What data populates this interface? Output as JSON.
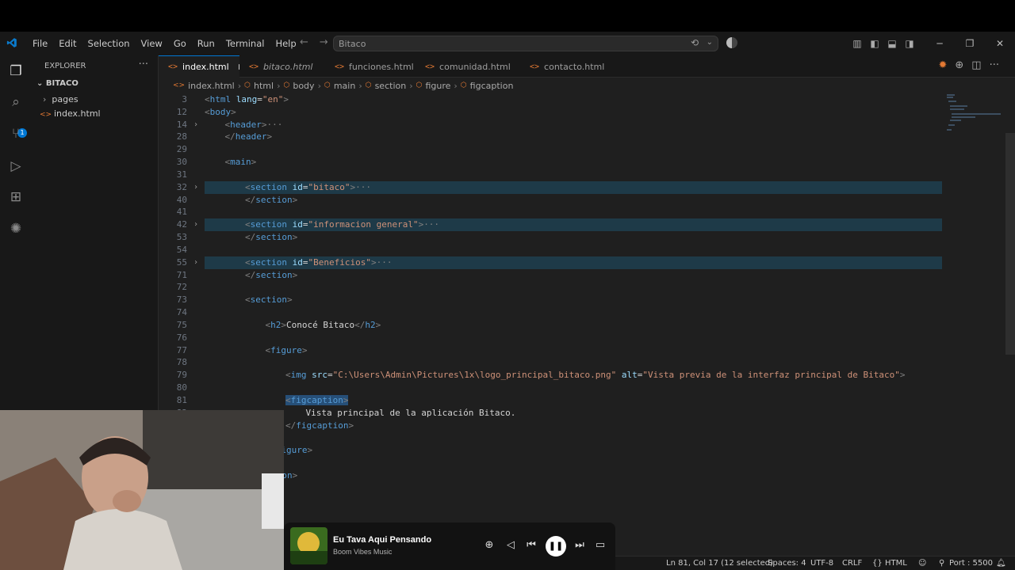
{
  "titlebar": {
    "menu": [
      "File",
      "Edit",
      "Selection",
      "View",
      "Go",
      "Run",
      "Terminal",
      "Help"
    ],
    "search": "Bitaco"
  },
  "sidebar": {
    "header": "EXPLORER",
    "more": "···",
    "root": "BITACO",
    "items": [
      {
        "label": "pages",
        "type": "folder"
      },
      {
        "label": "index.html",
        "type": "file"
      }
    ],
    "badge": "1"
  },
  "tabs": [
    {
      "label": "index.html",
      "active": true,
      "dirty": true
    },
    {
      "label": "bitaco.html",
      "active": false,
      "italic": true
    },
    {
      "label": "funciones.html",
      "active": false
    },
    {
      "label": "comunidad.html",
      "active": false
    },
    {
      "label": "contacto.html",
      "active": false
    }
  ],
  "breadcrumb": [
    "index.html",
    "html",
    "body",
    "main",
    "section",
    "figure",
    "figcaption"
  ],
  "editor": {
    "lines": [
      {
        "n": "3",
        "indent": 0,
        "html": "<span class='t-br'>&lt;</span><span class='t-tag'>html</span> <span class='t-attr'>lang</span><span class='t-txt'>=</span><span class='t-str'>\"en\"</span><span class='t-br'>&gt;</span>"
      },
      {
        "n": "12",
        "indent": 0,
        "html": "<span class='t-br'>&lt;</span><span class='t-tag'>body</span><span class='t-br'>&gt;</span>"
      },
      {
        "n": "14",
        "indent": 1,
        "fold": true,
        "html": "<span class='t-br'>&lt;</span><span class='t-tag'>header</span><span class='t-br'>&gt;</span><span class='t-br'>···</span>"
      },
      {
        "n": "28",
        "indent": 1,
        "html": "<span class='t-br'>&lt;/</span><span class='t-tag'>header</span><span class='t-br'>&gt;</span>"
      },
      {
        "n": "29",
        "indent": 0,
        "html": ""
      },
      {
        "n": "30",
        "indent": 1,
        "html": "<span class='t-br'>&lt;</span><span class='t-tag'>main</span><span class='t-br'>&gt;</span>"
      },
      {
        "n": "31",
        "indent": 0,
        "html": ""
      },
      {
        "n": "32",
        "indent": 2,
        "fold": true,
        "hl": true,
        "html": "<span class='t-br'>&lt;</span><span class='t-tag'>section</span> <span class='t-attr'>id</span><span class='t-txt'>=</span><span class='t-str'>\"bitaco\"</span><span class='t-br'>&gt;</span><span class='t-br'>···</span>"
      },
      {
        "n": "40",
        "indent": 2,
        "html": "<span class='t-br'>&lt;/</span><span class='t-tag'>section</span><span class='t-br'>&gt;</span>"
      },
      {
        "n": "41",
        "indent": 0,
        "html": ""
      },
      {
        "n": "42",
        "indent": 2,
        "fold": true,
        "hl": true,
        "html": "<span class='t-br'>&lt;</span><span class='t-tag'>section</span> <span class='t-attr'>id</span><span class='t-txt'>=</span><span class='t-str'>\"informacion general\"</span><span class='t-br'>&gt;</span><span class='t-br'>···</span>"
      },
      {
        "n": "53",
        "indent": 2,
        "html": "<span class='t-br'>&lt;/</span><span class='t-tag'>section</span><span class='t-br'>&gt;</span>"
      },
      {
        "n": "54",
        "indent": 0,
        "html": ""
      },
      {
        "n": "55",
        "indent": 2,
        "fold": true,
        "hl": true,
        "html": "<span class='t-br'>&lt;</span><span class='t-tag'>section</span> <span class='t-attr'>id</span><span class='t-txt'>=</span><span class='t-str'>\"Beneficios\"</span><span class='t-br'>&gt;</span><span class='t-br'>···</span>"
      },
      {
        "n": "71",
        "indent": 2,
        "html": "<span class='t-br'>&lt;/</span><span class='t-tag'>section</span><span class='t-br'>&gt;</span>"
      },
      {
        "n": "72",
        "indent": 0,
        "html": ""
      },
      {
        "n": "73",
        "indent": 2,
        "html": "<span class='t-br'>&lt;</span><span class='t-tag'>section</span><span class='t-br'>&gt;</span>"
      },
      {
        "n": "74",
        "indent": 0,
        "html": ""
      },
      {
        "n": "75",
        "indent": 3,
        "html": "<span class='t-br'>&lt;</span><span class='t-tag'>h2</span><span class='t-br'>&gt;</span><span class='t-txt'>Conocé Bitaco</span><span class='t-br'>&lt;/</span><span class='t-tag'>h2</span><span class='t-br'>&gt;</span>"
      },
      {
        "n": "76",
        "indent": 0,
        "html": ""
      },
      {
        "n": "77",
        "indent": 3,
        "html": "<span class='t-br'>&lt;</span><span class='t-tag'>figure</span><span class='t-br'>&gt;</span>"
      },
      {
        "n": "78",
        "indent": 0,
        "html": ""
      },
      {
        "n": "79",
        "indent": 4,
        "html": "<span class='t-br'>&lt;</span><span class='t-tag'>img</span> <span class='t-attr'>src</span><span class='t-txt'>=</span><span class='t-str'>\"C:\\Users\\Admin\\Pictures\\1x\\logo_principal_bitaco.png\"</span> <span class='t-attr'>alt</span><span class='t-txt'>=</span><span class='t-str'>\"Vista previa de la interfaz principal de Bitaco\"</span><span class='t-br'>&gt;</span>"
      },
      {
        "n": "80",
        "indent": 0,
        "html": ""
      },
      {
        "n": "81",
        "indent": 4,
        "html": "<span class='sel'><span class='t-br'>&lt;</span><span class='t-tag'>figcaption</span><span class='t-br'>&gt;</span></span>"
      },
      {
        "n": "82",
        "indent": 5,
        "html": "<span class='t-txt'>Vista principal de la aplicación Bitaco.</span>"
      },
      {
        "n": "83",
        "indent": 4,
        "html": "<span class='t-br'>&lt;/</span><span class='t-tag'>figcaption</span><span class='t-br'>&gt;</span>"
      },
      {
        "n": "84",
        "indent": 0,
        "html": ""
      },
      {
        "n": "85",
        "indent": 3,
        "html": "<span class='t-br'>&lt;/</span><span class='t-tag'>figure</span><span class='t-br'>&gt;</span>"
      },
      {
        "n": "86",
        "indent": 0,
        "html": ""
      },
      {
        "n": "87",
        "indent": 2,
        "html": "<span class='t-br'>&lt;/</span><span class='t-tag'>section</span><span class='t-br'>&gt;</span>"
      }
    ]
  },
  "statusbar": {
    "position": "Ln 81, Col 17 (12 selected)",
    "spaces": "Spaces: 4",
    "encoding": "UTF-8",
    "eol": "CRLF",
    "lang_mode": "HTML",
    "port": "Port : 5500"
  },
  "player": {
    "song": "Eu Tava Aqui Pensando",
    "artist": "Boom Vibes Music",
    "art_text": "Eu Tava Aqui Pensando"
  },
  "colors": {
    "accent": "#0078d4",
    "html_icon": "#e37933",
    "tag": "#569cd6",
    "attr": "#9cdcfe",
    "string": "#ce9178"
  }
}
